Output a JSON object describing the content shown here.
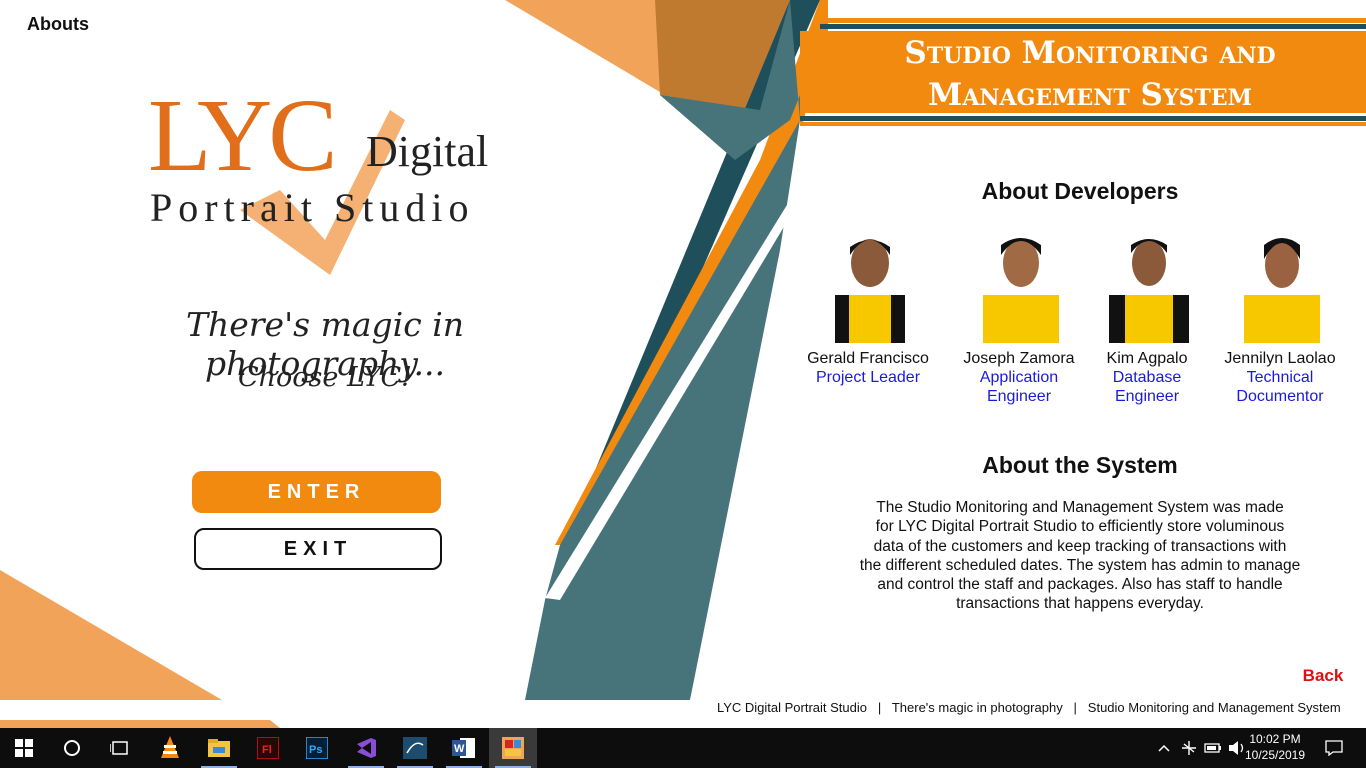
{
  "window": {
    "title": "Abouts"
  },
  "logo": {
    "brand": "LYC",
    "digital": "Digital",
    "studio": "Portrait Studio"
  },
  "tagline": {
    "line1": "There's magic in photography...",
    "line2": "Choose LYC!"
  },
  "buttons": {
    "enter": "ENTER",
    "exit": "EXIT",
    "back": "Back"
  },
  "header": {
    "title_line1": "Studio Monitoring and",
    "title_line2": "Management System"
  },
  "about_developers": {
    "title": "About Developers",
    "developers": [
      {
        "name": "Gerald Francisco",
        "role": "Project Leader"
      },
      {
        "name": "Joseph Zamora",
        "role": "Application Engineer"
      },
      {
        "name": "Kim Agpalo",
        "role": "Database Engineer"
      },
      {
        "name": "Jennilyn Laolao",
        "role": "Technical Documentor"
      }
    ]
  },
  "about_system": {
    "title": "About the System",
    "lines": [
      "The Studio Monitoring and Management System was made",
      "for LYC Digital Portrait Studio to efficiently store voluminous",
      "data of the customers and keep tracking of transactions with",
      "the different scheduled dates. The system has admin to manage",
      "and control the staff and packages. Also has staff to handle",
      "transactions that happens everyday."
    ]
  },
  "footer": {
    "part1": "LYC Digital Portrait Studio",
    "sep": "|",
    "part2": "There's magic in photography",
    "part3": "Studio Monitoring and Management System"
  },
  "taskbar": {
    "apps": [
      "windows-start",
      "cortana",
      "task-view",
      "vlc",
      "file-explorer",
      "flash",
      "photoshop",
      "visual-studio",
      "mysql-workbench",
      "word",
      "app-active"
    ],
    "time": "10:02 PM",
    "date": "10/25/2019"
  },
  "colors": {
    "orange": "#f28a10",
    "light_orange": "#f2a35a",
    "teal": "#47737a",
    "dark_teal": "#1f4f5a",
    "brown_orange": "#c07a30"
  }
}
